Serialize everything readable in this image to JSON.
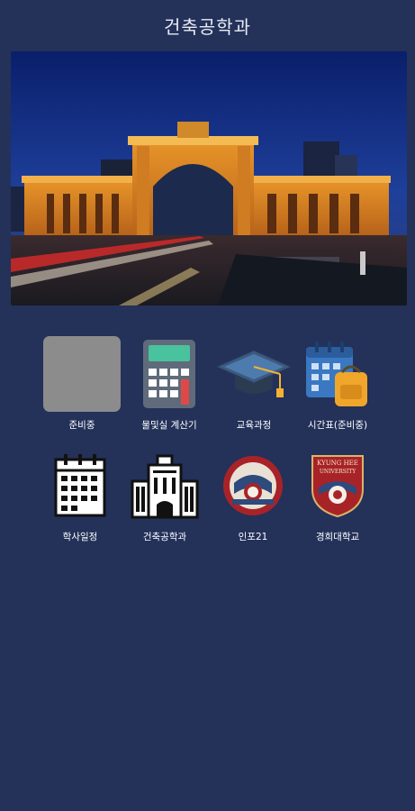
{
  "header": {
    "title": "건축공학과"
  },
  "hero": {
    "alt": "campus gate night photo"
  },
  "menu": {
    "items": [
      {
        "label": "준비중",
        "icon": "placeholder-icon"
      },
      {
        "label": "물및실 계산기",
        "icon": "calculator-icon"
      },
      {
        "label": "교육과정",
        "icon": "graduation-cap-icon"
      },
      {
        "label": "시간표(준비중)",
        "icon": "schedule-backpack-icon"
      },
      {
        "label": "학사일정",
        "icon": "calendar-icon"
      },
      {
        "label": "건축공학과",
        "icon": "building-icon"
      },
      {
        "label": "인포21",
        "icon": "emblem-icon"
      },
      {
        "label": "경희대학교",
        "icon": "university-crest-icon"
      }
    ]
  },
  "crest": {
    "line1": "KYUNG HEE",
    "line2": "UNIVERSITY"
  },
  "colors": {
    "background": "#243159",
    "accent_red": "#b5262b",
    "gold": "#f2b42a"
  }
}
